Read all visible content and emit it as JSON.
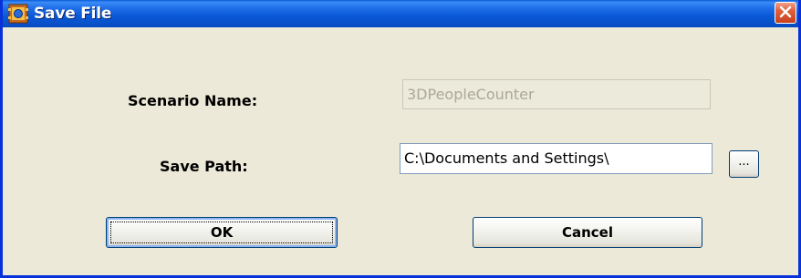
{
  "window": {
    "title": "Save File",
    "title_icon": "app-icon",
    "close_icon": "close-icon",
    "accent_color": "#0a58d6",
    "close_color": "#e0603a"
  },
  "form": {
    "scenario_name_label": "Scenario Name:",
    "scenario_name_value": "3DPeopleCounter",
    "save_path_label": "Save Path:",
    "save_path_value": "C:\\Documents and Settings\\",
    "browse_label": "..."
  },
  "buttons": {
    "ok_label": "OK",
    "cancel_label": "Cancel"
  }
}
